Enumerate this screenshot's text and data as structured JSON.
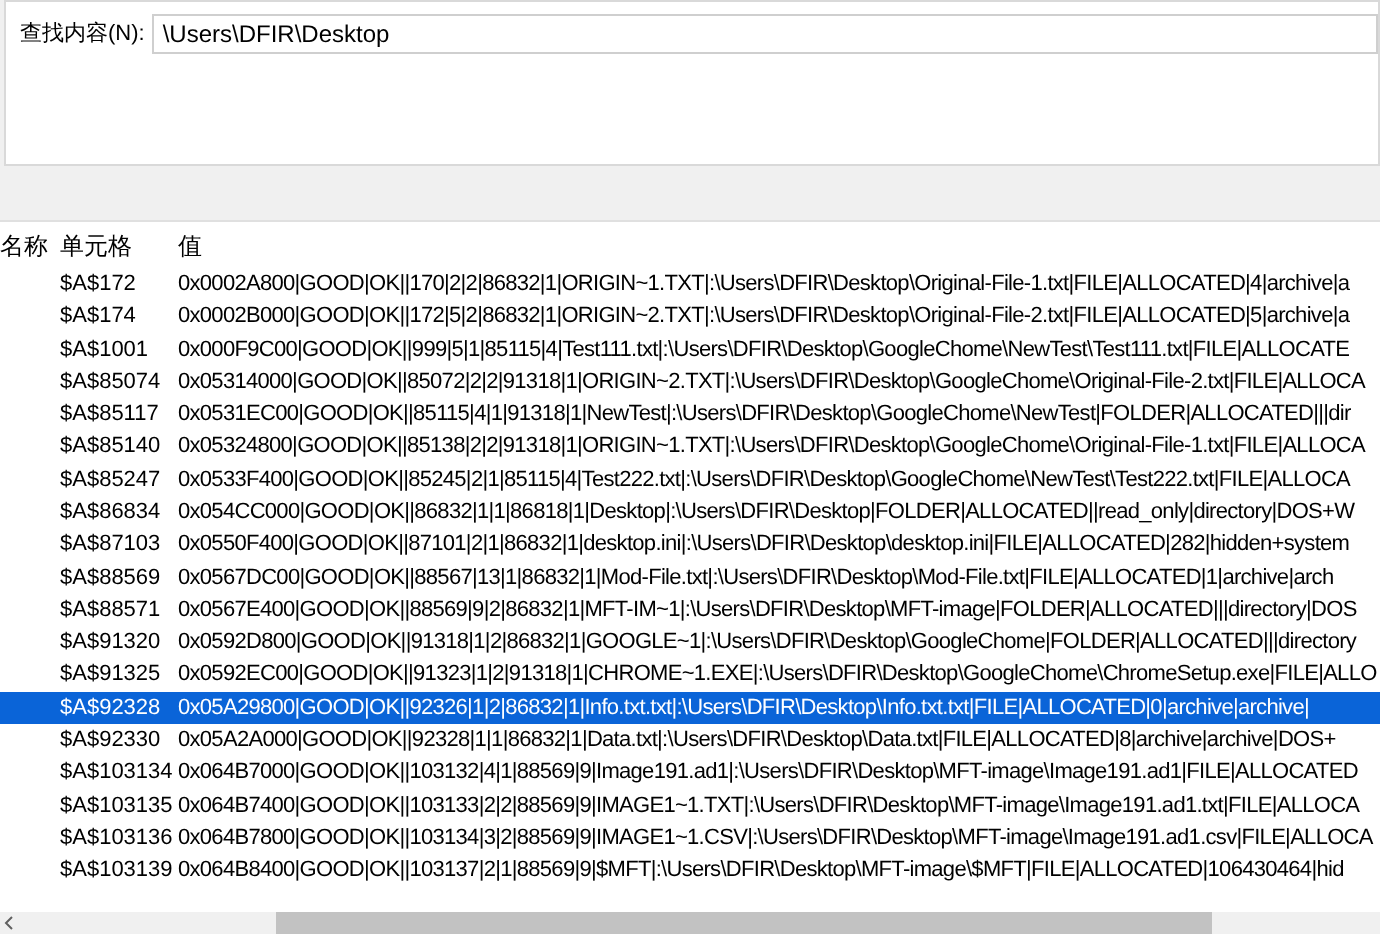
{
  "search": {
    "label": "查找内容(N):",
    "value": "\\Users\\DFIR\\Desktop"
  },
  "table": {
    "columns": [
      "名称",
      "单元格",
      "值"
    ],
    "rows": [
      {
        "cell": "$A$172",
        "value": "0x0002A800|GOOD|OK||170|2|2|86832|1|ORIGIN~1.TXT|:\\Users\\DFIR\\Desktop\\Original-File-1.txt|FILE|ALLOCATED|4|archive|a",
        "selected": false
      },
      {
        "cell": "$A$174",
        "value": "0x0002B000|GOOD|OK||172|5|2|86832|1|ORIGIN~2.TXT|:\\Users\\DFIR\\Desktop\\Original-File-2.txt|FILE|ALLOCATED|5|archive|a",
        "selected": false
      },
      {
        "cell": "$A$1001",
        "value": "0x000F9C00|GOOD|OK||999|5|1|85115|4|Test111.txt|:\\Users\\DFIR\\Desktop\\GoogleChome\\NewTest\\Test111.txt|FILE|ALLOCATE",
        "selected": false
      },
      {
        "cell": "$A$85074",
        "value": "0x05314000|GOOD|OK||85072|2|2|91318|1|ORIGIN~2.TXT|:\\Users\\DFIR\\Desktop\\GoogleChome\\Original-File-2.txt|FILE|ALLOCA",
        "selected": false
      },
      {
        "cell": "$A$85117",
        "value": "0x0531EC00|GOOD|OK||85115|4|1|91318|1|NewTest|:\\Users\\DFIR\\Desktop\\GoogleChome\\NewTest|FOLDER|ALLOCATED|||dir",
        "selected": false
      },
      {
        "cell": "$A$85140",
        "value": "0x05324800|GOOD|OK||85138|2|2|91318|1|ORIGIN~1.TXT|:\\Users\\DFIR\\Desktop\\GoogleChome\\Original-File-1.txt|FILE|ALLOCA",
        "selected": false
      },
      {
        "cell": "$A$85247",
        "value": "0x0533F400|GOOD|OK||85245|2|1|85115|4|Test222.txt|:\\Users\\DFIR\\Desktop\\GoogleChome\\NewTest\\Test222.txt|FILE|ALLOCA",
        "selected": false
      },
      {
        "cell": "$A$86834",
        "value": "0x054CC000|GOOD|OK||86832|1|1|86818|1|Desktop|:\\Users\\DFIR\\Desktop|FOLDER|ALLOCATED||read_only|directory|DOS+W",
        "selected": false
      },
      {
        "cell": "$A$87103",
        "value": "0x0550F400|GOOD|OK||87101|2|1|86832|1|desktop.ini|:\\Users\\DFIR\\Desktop\\desktop.ini|FILE|ALLOCATED|282|hidden+system",
        "selected": false
      },
      {
        "cell": "$A$88569",
        "value": "0x0567DC00|GOOD|OK||88567|13|1|86832|1|Mod-File.txt|:\\Users\\DFIR\\Desktop\\Mod-File.txt|FILE|ALLOCATED|1|archive|arch",
        "selected": false
      },
      {
        "cell": "$A$88571",
        "value": "0x0567E400|GOOD|OK||88569|9|2|86832|1|MFT-IM~1|:\\Users\\DFIR\\Desktop\\MFT-image|FOLDER|ALLOCATED|||directory|DOS",
        "selected": false
      },
      {
        "cell": "$A$91320",
        "value": "0x0592D800|GOOD|OK||91318|1|2|86832|1|GOOGLE~1|:\\Users\\DFIR\\Desktop\\GoogleChome|FOLDER|ALLOCATED|||directory",
        "selected": false
      },
      {
        "cell": "$A$91325",
        "value": "0x0592EC00|GOOD|OK||91323|1|2|91318|1|CHROME~1.EXE|:\\Users\\DFIR\\Desktop\\GoogleChome\\ChromeSetup.exe|FILE|ALLO",
        "selected": false
      },
      {
        "cell": "$A$92328",
        "value": "0x05A29800|GOOD|OK||92326|1|2|86832|1|Info.txt.txt|:\\Users\\DFIR\\Desktop\\Info.txt.txt|FILE|ALLOCATED|0|archive|archive|",
        "selected": true
      },
      {
        "cell": "$A$92330",
        "value": "0x05A2A000|GOOD|OK||92328|1|1|86832|1|Data.txt|:\\Users\\DFIR\\Desktop\\Data.txt|FILE|ALLOCATED|8|archive|archive|DOS+",
        "selected": false
      },
      {
        "cell": "$A$103134",
        "value": "0x064B7000|GOOD|OK||103132|4|1|88569|9|Image191.ad1|:\\Users\\DFIR\\Desktop\\MFT-image\\Image191.ad1|FILE|ALLOCATED",
        "selected": false
      },
      {
        "cell": "$A$103135",
        "value": "0x064B7400|GOOD|OK||103133|2|2|88569|9|IMAGE1~1.TXT|:\\Users\\DFIR\\Desktop\\MFT-image\\Image191.ad1.txt|FILE|ALLOCA",
        "selected": false
      },
      {
        "cell": "$A$103136",
        "value": "0x064B7800|GOOD|OK||103134|3|2|88569|9|IMAGE1~1.CSV|:\\Users\\DFIR\\Desktop\\MFT-image\\Image191.ad1.csv|FILE|ALLOCA",
        "selected": false
      },
      {
        "cell": "$A$103139",
        "value": "0x064B8400|GOOD|OK||103137|2|1|88569|9|$MFT|:\\Users\\DFIR\\Desktop\\MFT-image\\$MFT|FILE|ALLOCATED|106430464|hid",
        "selected": false
      }
    ]
  }
}
